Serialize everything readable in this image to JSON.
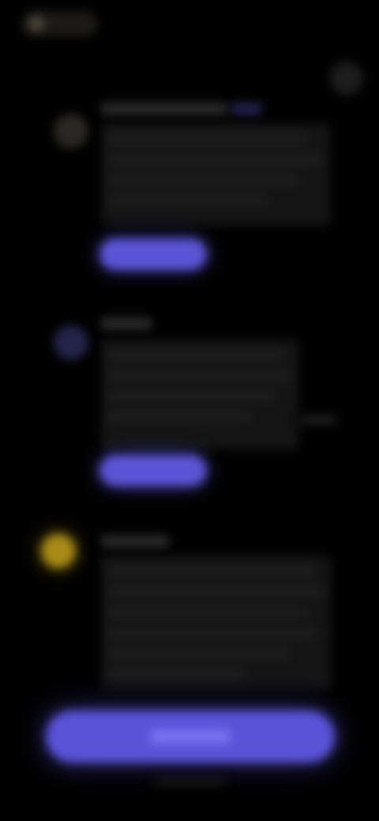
{
  "colors": {
    "background": "#000000",
    "accent": "#5b54d6",
    "step_one_icon": "#2a2824",
    "step_two_icon": "#24244a",
    "step_three_icon": "#a88a16",
    "card": "#141414"
  },
  "header": {
    "back_icon": "back-icon",
    "close_icon": "close-icon"
  },
  "steps": [
    {
      "icon": "step-one-icon"
    },
    {
      "icon": "step-two-icon"
    },
    {
      "icon": "step-three-icon"
    }
  ],
  "primary_action": {}
}
